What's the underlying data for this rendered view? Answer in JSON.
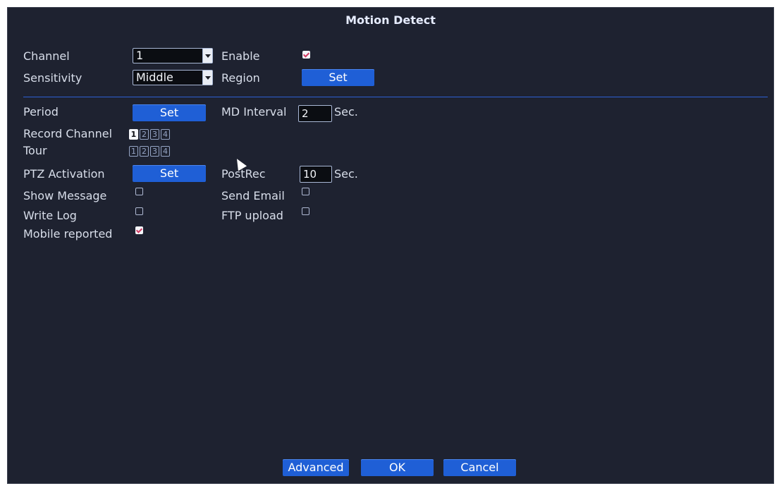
{
  "window": {
    "title": "Motion Detect"
  },
  "channel": {
    "label": "Channel",
    "value": "1"
  },
  "enable": {
    "label": "Enable",
    "checked": true
  },
  "sensitivity": {
    "label": "Sensitivity",
    "value": "Middle"
  },
  "region": {
    "label": "Region",
    "button": "Set"
  },
  "period": {
    "label": "Period",
    "button": "Set"
  },
  "md_interval": {
    "label": "MD Interval",
    "value": "2",
    "unit": "Sec."
  },
  "record_channel": {
    "label": "Record Channel",
    "channels": [
      "1",
      "2",
      "3",
      "4"
    ],
    "selected": [
      "1"
    ]
  },
  "tour": {
    "label": "Tour",
    "channels": [
      "1",
      "2",
      "3",
      "4"
    ],
    "selected": []
  },
  "ptz": {
    "label": "PTZ Activation",
    "button": "Set"
  },
  "postrec": {
    "label": "PostRec",
    "value": "10",
    "unit": "Sec."
  },
  "show_message": {
    "label": "Show Message",
    "checked": false
  },
  "send_email": {
    "label": "Send Email",
    "checked": false
  },
  "write_log": {
    "label": "Write Log",
    "checked": false
  },
  "ftp_upload": {
    "label": "FTP upload",
    "checked": false
  },
  "mobile_reported": {
    "label": "Mobile reported",
    "checked": true
  },
  "footer": {
    "advanced": "Advanced",
    "ok": "OK",
    "cancel": "Cancel"
  },
  "colors": {
    "panel": "#1e2230",
    "accent": "#1f5fd6",
    "separator": "#2d5fd3"
  }
}
